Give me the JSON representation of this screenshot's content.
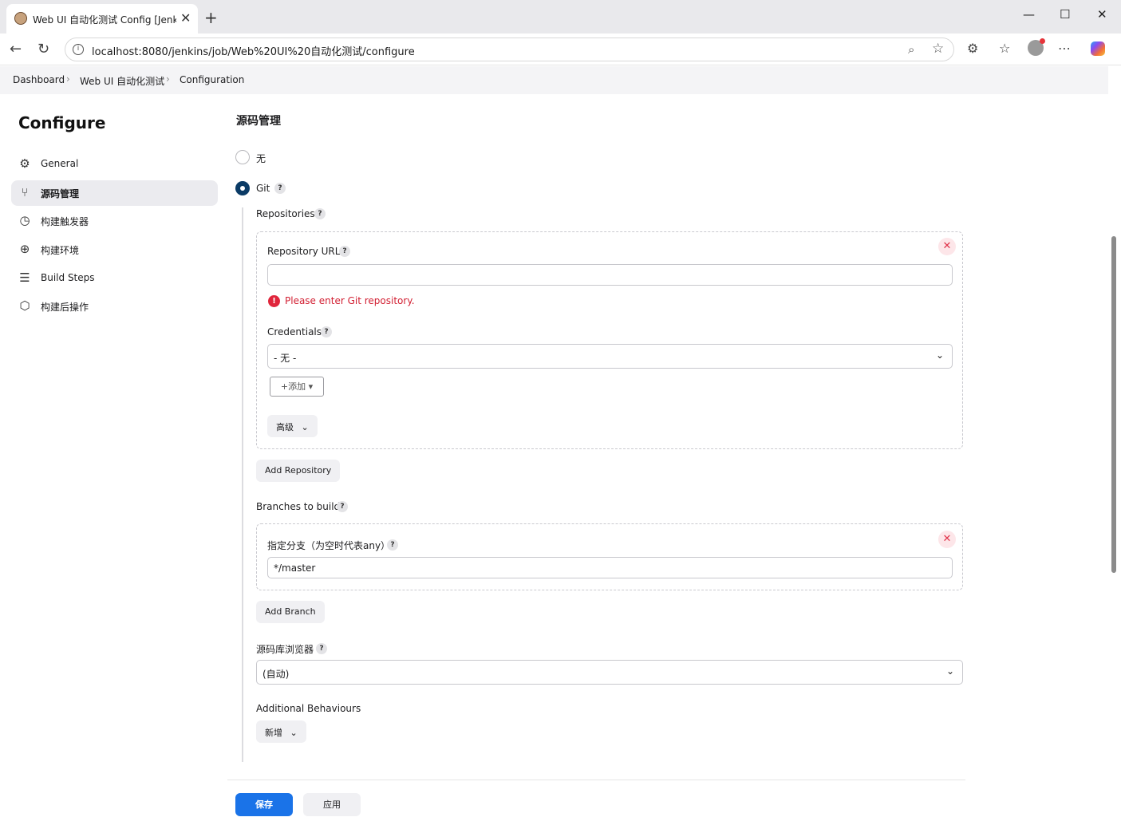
{
  "browser": {
    "tab_title": "Web UI 自动化测试 Config [Jenkins]",
    "url": "localhost:8080/jenkins/job/Web%20UI%20自动化测试/configure"
  },
  "breadcrumb": {
    "items": [
      "Dashboard",
      "Web UI 自动化测试",
      "Configuration"
    ]
  },
  "sidebar": {
    "title": "Configure",
    "items": [
      {
        "label": "General",
        "icon": "gear-icon"
      },
      {
        "label": "源码管理",
        "icon": "branch-icon"
      },
      {
        "label": "构建触发器",
        "icon": "clock-icon"
      },
      {
        "label": "构建环境",
        "icon": "globe-icon"
      },
      {
        "label": "Build Steps",
        "icon": "list-icon"
      },
      {
        "label": "构建后操作",
        "icon": "package-icon"
      }
    ],
    "active": "源码管理"
  },
  "scm": {
    "title": "源码管理",
    "option_none": "无",
    "option_git": "Git",
    "selected": "Git",
    "repositories_label": "Repositories",
    "repo_url_label": "Repository URL",
    "repo_url_value": "",
    "repo_url_error": "Please enter Git repository.",
    "credentials_label": "Credentials",
    "credentials_value": "- 无 -",
    "add_button": "+添加 ▾",
    "advanced_button": "高级",
    "add_repository_button": "Add Repository",
    "branches_label": "Branches to build",
    "branch_specifier_label": "指定分支（为空时代表any）",
    "branch_specifier_value": "*/master",
    "add_branch_button": "Add Branch",
    "repo_browser_label": "源码库浏览器",
    "repo_browser_value": "(自动)",
    "additional_behaviours_label": "Additional Behaviours",
    "add_behaviour_button": "新增"
  },
  "footer": {
    "save": "保存",
    "apply": "应用"
  },
  "colors": {
    "primary": "#1a73e8",
    "radio_selected": "#0b3b66",
    "error": "#d21f32"
  }
}
